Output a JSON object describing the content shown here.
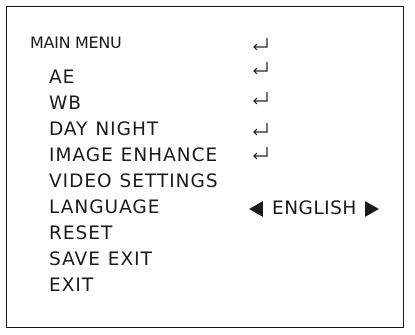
{
  "title": "MAIN MENU",
  "items": [
    {
      "label": "AE",
      "submenu": true,
      "icon": "enter-icon"
    },
    {
      "label": "WB",
      "submenu": true,
      "icon": "enter-icon"
    },
    {
      "label": "DAY NIGHT",
      "submenu": true,
      "icon": "enter-icon"
    },
    {
      "label": "IMAGE ENHANCE",
      "submenu": true,
      "icon": "enter-icon"
    },
    {
      "label": "VIDEO SETTINGS",
      "submenu": true,
      "icon": "enter-icon"
    },
    {
      "label": "LANGUAGE",
      "value": "ENGLISH",
      "icons": [
        "left-triangle-icon",
        "right-triangle-icon"
      ]
    },
    {
      "label": "RESET"
    },
    {
      "label": "SAVE EXIT"
    },
    {
      "label": "EXIT"
    }
  ],
  "colors": {
    "text": "#1a1a1a",
    "background": "#ffffff"
  }
}
